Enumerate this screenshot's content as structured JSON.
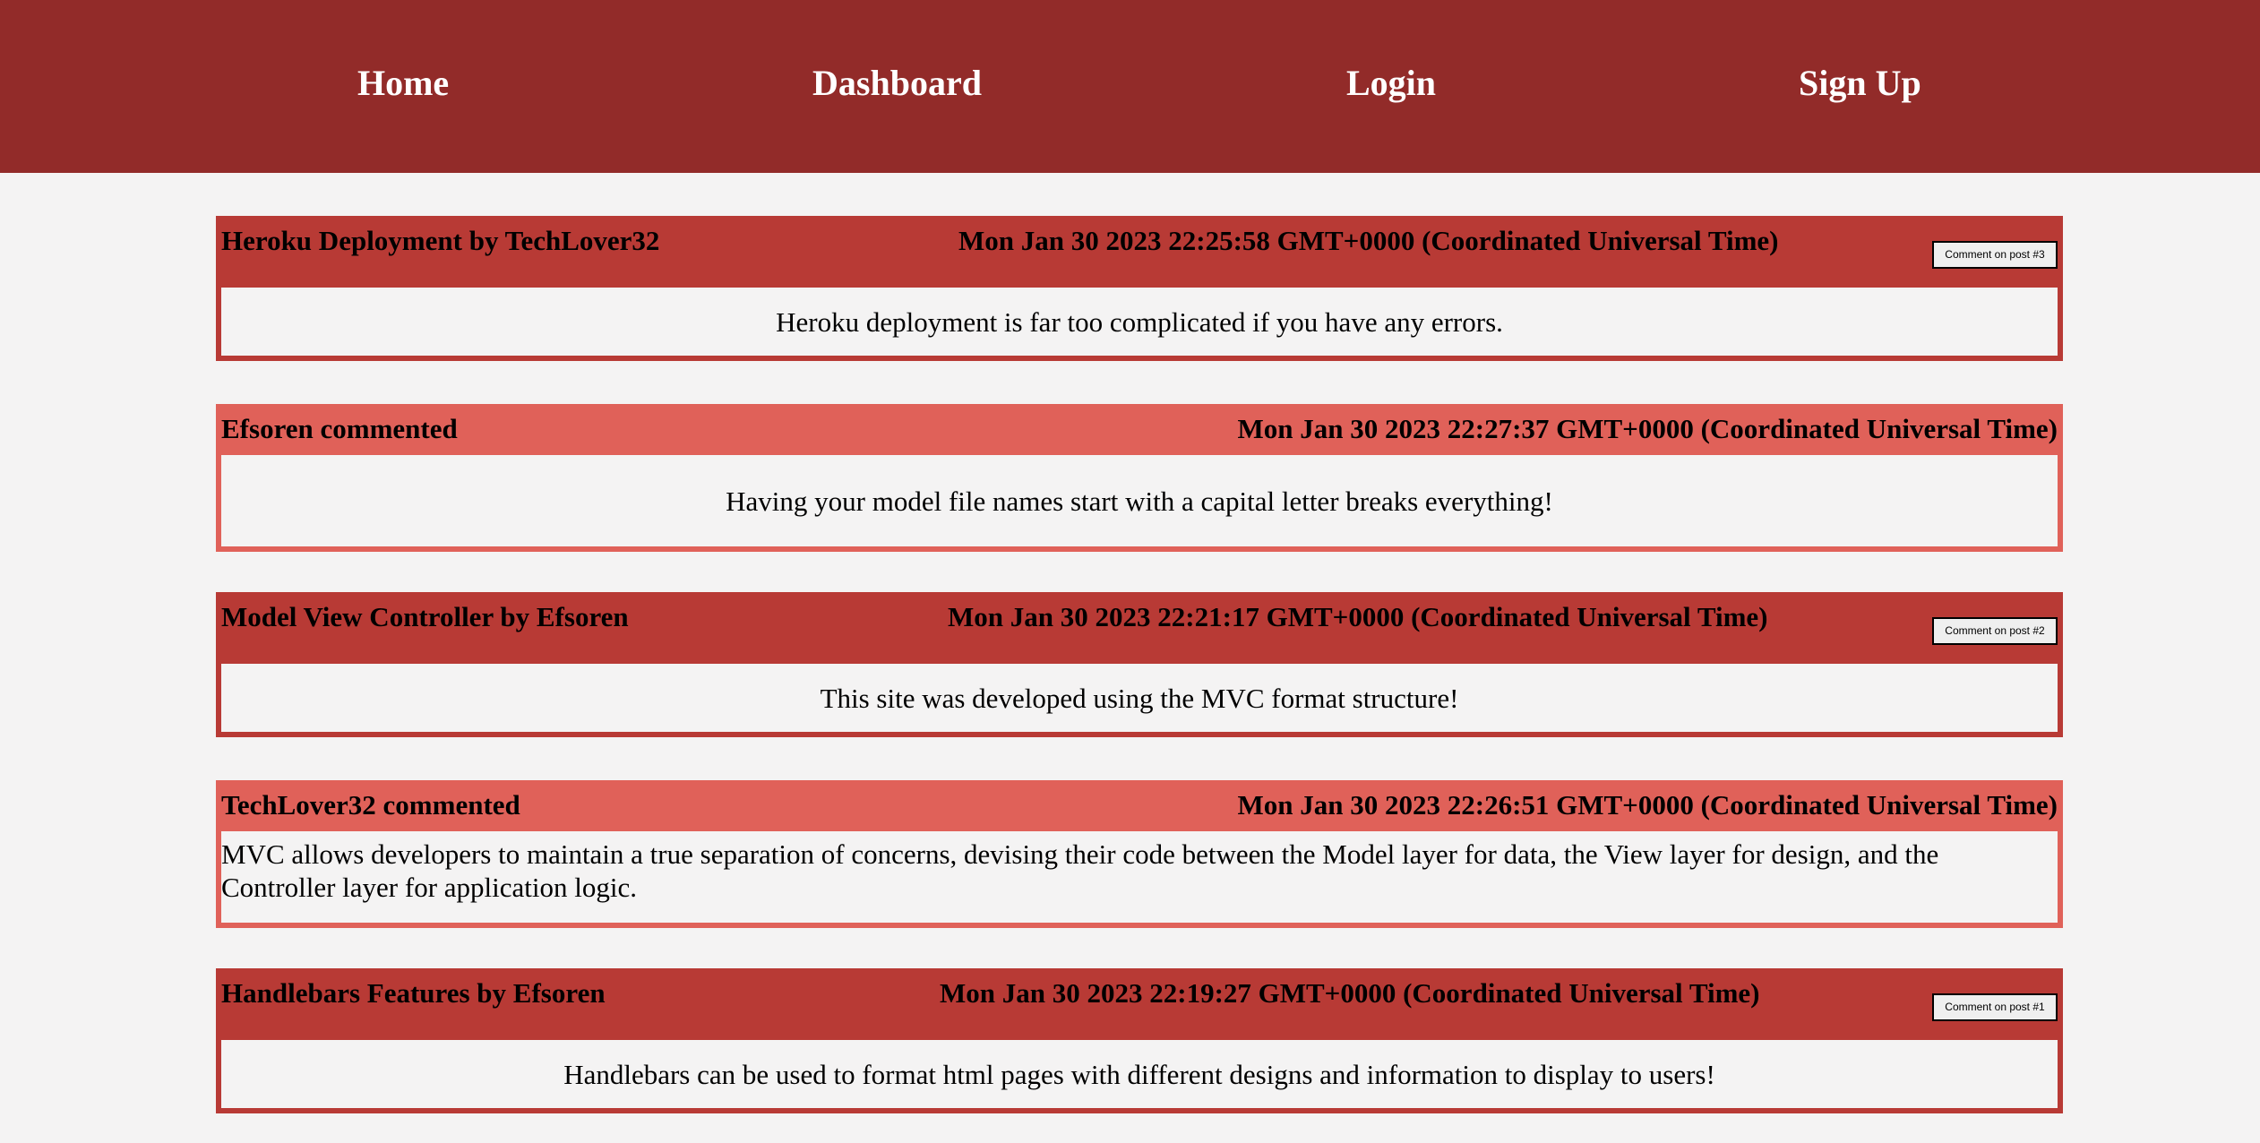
{
  "nav": {
    "home": "Home",
    "dashboard": "Dashboard",
    "login": "Login",
    "signup": "Sign Up"
  },
  "feed": [
    {
      "kind": "post",
      "title": "Heroku Deployment by TechLover32",
      "date": "Mon Jan 30 2023 22:25:58 GMT+0000 (Coordinated Universal Time)",
      "button": "Comment on post #3",
      "body": "Heroku deployment is far too complicated if you have any errors."
    },
    {
      "kind": "comment",
      "title": "Efsoren commented",
      "date": "Mon Jan 30 2023 22:27:37 GMT+0000 (Coordinated Universal Time)",
      "body": "Having your model file names start with a capital letter breaks everything!"
    },
    {
      "kind": "post",
      "title": "Model View Controller by Efsoren",
      "date": "Mon Jan 30 2023 22:21:17 GMT+0000 (Coordinated Universal Time)",
      "button": "Comment on post #2",
      "body": "This site was developed using the MVC format structure!"
    },
    {
      "kind": "comment",
      "title": "TechLover32 commented",
      "date": "Mon Jan 30 2023 22:26:51 GMT+0000 (Coordinated Universal Time)",
      "body": "MVC allows developers to maintain a true separation of concerns, devising their code between the Model layer for data, the View layer for design, and the Controller layer for application logic."
    },
    {
      "kind": "post",
      "title": "Handlebars Features by Efsoren",
      "date": "Mon Jan 30 2023 22:19:27 GMT+0000 (Coordinated Universal Time)",
      "button": "Comment on post #1",
      "body": "Handlebars can be used to format html pages with different designs and information to display to users!"
    }
  ],
  "colors": {
    "navbar": "#922b29",
    "post": "#b83a35",
    "comment": "#e06159",
    "background": "#f4f3f3"
  }
}
